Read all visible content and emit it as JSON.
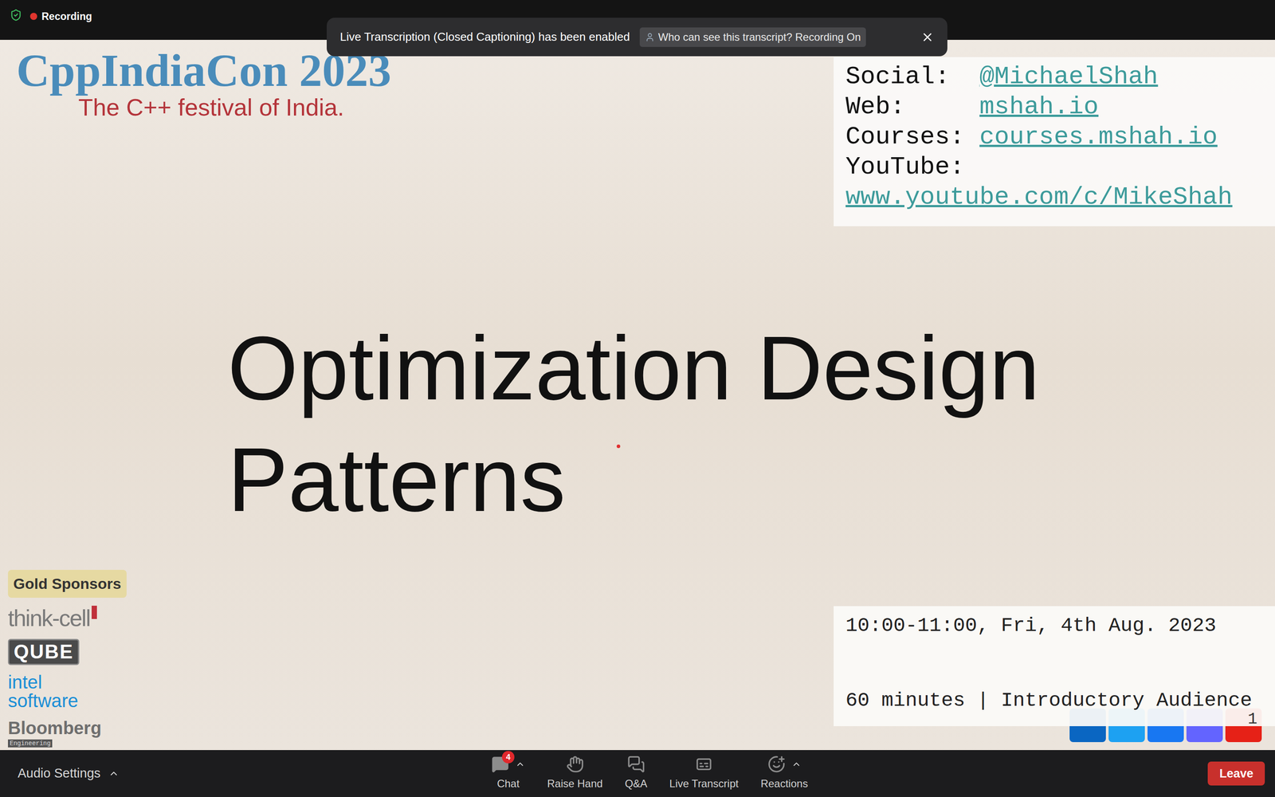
{
  "top_bar": {
    "recording": {
      "label": "Recording",
      "on": true
    }
  },
  "notification": {
    "message": "Live Transcription (Closed Captioning) has been enabled",
    "button": "Who can see this transcript? Recording On"
  },
  "slide": {
    "logo": {
      "title": "CppIndiaCon 2023",
      "subtitle": "The C++ festival of India."
    },
    "contact": [
      {
        "label": "Social:",
        "value": "@MichaelShah"
      },
      {
        "label": "Web:",
        "value": "mshah.io"
      },
      {
        "label": "Courses:",
        "value": "courses.mshah.io"
      },
      {
        "label": "YouTube:",
        "value": "www.youtube.com/c/MikeShah"
      }
    ],
    "title": "Optimization Design Patterns",
    "laser_pointer": {
      "visible": true
    },
    "sponsors": {
      "label": "Gold Sponsors",
      "items": [
        {
          "kind": "wordmark",
          "lines": [
            "think-cell"
          ],
          "color": "#7a7a7a"
        },
        {
          "kind": "boxed",
          "lines": [
            "QUBE"
          ],
          "color": "#4a4a4a"
        },
        {
          "kind": "intel",
          "lines": [
            "intel",
            "software"
          ],
          "color": "#1b8fd6"
        },
        {
          "kind": "bloomberg",
          "lines": [
            "Bloomberg",
            "Engineering"
          ],
          "color": "#6e6e6e"
        }
      ]
    },
    "schedule": "10:00-11:00, Fri, 4th Aug. 2023",
    "audience": "60 minutes | Introductory Audience",
    "page_number": "1",
    "social_icons": [
      {
        "color": "#0a66c2"
      },
      {
        "color": "#1da1f2"
      },
      {
        "color": "#1877f2"
      },
      {
        "color": "#6364ff"
      },
      {
        "color": "#e62117"
      }
    ]
  },
  "toolbar": {
    "audio_settings": "Audio Settings",
    "controls": [
      {
        "label": "Chat",
        "badge": "4",
        "menu": true
      },
      {
        "label": "Raise Hand",
        "badge": "",
        "menu": false
      },
      {
        "label": "Q&A",
        "badge": "",
        "menu": false
      },
      {
        "label": "Live Transcript",
        "badge": "",
        "menu": false
      },
      {
        "label": "Reactions",
        "badge": "",
        "menu": true
      }
    ],
    "leave": "Leave"
  }
}
